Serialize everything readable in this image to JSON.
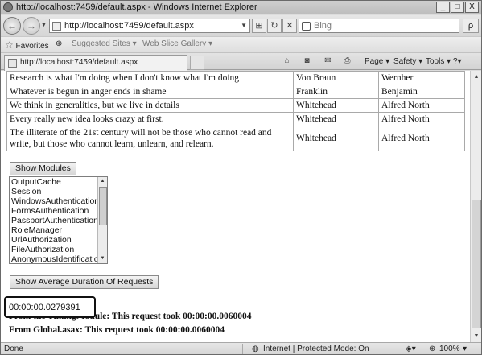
{
  "window": {
    "title": "http://localhost:7459/default.aspx - Windows Internet Explorer",
    "minimize": "_",
    "maximize": "□",
    "close": "X"
  },
  "nav": {
    "back": "←",
    "forward": "→",
    "address": "http://localhost:7459/default.aspx",
    "search_placeholder": "Bing",
    "search_go": "ρ"
  },
  "favorites_bar": {
    "favorites_label": "Favorites",
    "suggested_sites": "Suggested Sites ▾",
    "web_slice_gallery": "Web Slice Gallery ▾"
  },
  "tab": {
    "label": "http://localhost:7459/default.aspx"
  },
  "commands": {
    "page": "Page ▾",
    "safety": "Safety ▾",
    "tools": "Tools ▾",
    "help": "?▾"
  },
  "quotes": [
    {
      "quote": "Research is what I'm doing when I don't know what I'm doing",
      "last": "Von Braun",
      "first": "Wernher"
    },
    {
      "quote": "Whatever is begun in anger ends in shame",
      "last": "Franklin",
      "first": "Benjamin"
    },
    {
      "quote": "We think in generalities, but we live in details",
      "last": "Whitehead",
      "first": "Alfred North"
    },
    {
      "quote": "Every really new idea looks crazy at first.",
      "last": "Whitehead",
      "first": "Alfred North"
    },
    {
      "quote": "The illiterate of the 21st century will not be those who cannot read and write, but those who cannot learn, unlearn, and relearn.",
      "last": "Whitehead",
      "first": "Alfred North"
    }
  ],
  "show_modules_button": "Show Modules",
  "modules": [
    "OutputCache",
    "Session",
    "WindowsAuthentication",
    "FormsAuthentication",
    "PassportAuthentication",
    "RoleManager",
    "UrlAuthorization",
    "FileAuthorization",
    "AnonymousIdentification"
  ],
  "show_avg_button": "Show Average Duration Of Requests",
  "average_duration": "00:00:00.0279391",
  "timing_module_line": "From the TimingModule: This request took 00:00:00.0060004",
  "global_asax_line": "From Global.asax: This request took 00:00:00.0060004",
  "status_bar": {
    "left": "Done",
    "zone": "Internet | Protected Mode: On",
    "zoom": "100%"
  }
}
